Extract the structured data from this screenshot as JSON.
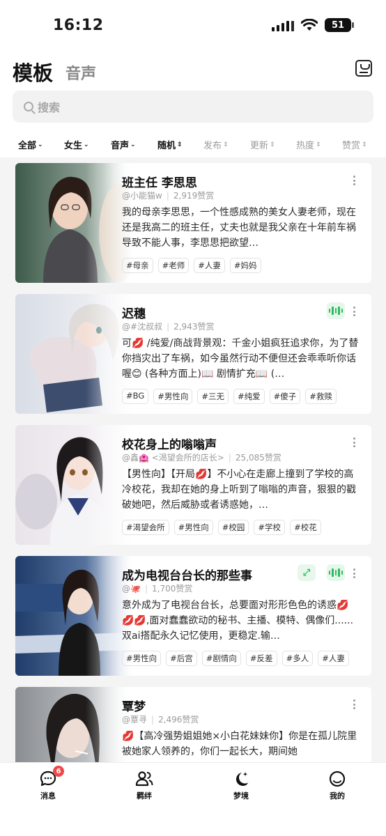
{
  "status": {
    "time": "16:12",
    "battery": "51"
  },
  "header": {
    "title": "模板",
    "subtitle": "音声"
  },
  "search": {
    "placeholder": "搜索"
  },
  "filters": [
    {
      "label": "全部",
      "active": true
    },
    {
      "label": "女生",
      "active": true
    },
    {
      "label": "音声",
      "active": true
    },
    {
      "label": "随机",
      "active": true
    },
    {
      "label": "发布",
      "active": false
    },
    {
      "label": "更新",
      "active": false
    },
    {
      "label": "热度",
      "active": false
    },
    {
      "label": "赞赏",
      "active": false
    }
  ],
  "cards": [
    {
      "title": "班主任 李思思",
      "author": "@小能猫w",
      "likes": "2,919赞赏",
      "desc": "我的母亲李思思，一个性感成熟的美女人妻老师，现在还是我高二的班主任，丈夫也就是我父亲在十年前车祸导致不能人事，李思思把欲望…",
      "tags": [
        "#母亲",
        "#老师",
        "#人妻",
        "#妈妈"
      ],
      "badges": []
    },
    {
      "title": "迟穗",
      "author": "@#沈叔叔",
      "likes": "2,943赞赏",
      "desc": "可💋 /纯爱/商战背景观：千金小姐疯狂追求你，为了替你挡灾出了车祸，如今虽然行动不便但还会乖乖听你话喔😊 (各种方面上)📖 剧情扩充📖 (…",
      "tags": [
        "#BG",
        "#男性向",
        "#三无",
        "#纯爱",
        "#傻子",
        "#救赎"
      ],
      "badges": [
        "voice"
      ]
    },
    {
      "title": "校花身上的嗡嗡声",
      "author": "@鑫🏩 <渴望会所的店长>",
      "likes": "25,085赞赏",
      "desc": "【男性向】【开局💋】不小心在走廊上撞到了学校的高冷校花，我却在她的身上听到了嗡嗡的声音，狠狠的戳破她吧，然后威胁或者诱惑她，…",
      "tags": [
        "#渴望会所",
        "#男性向",
        "#校园",
        "#学校",
        "#校花"
      ],
      "badges": []
    },
    {
      "title": "成为电视台台长的那些事",
      "author": "@🐙",
      "likes": "1,700赞赏",
      "desc": "意外成为了电视台台长，总要面对形形色色的诱惑💋💋💋,面对蠢蠢欲动的秘书、主播、模特、偶像们......双ai搭配永久记忆使用，更稳定.输…",
      "tags": [
        "#男性向",
        "#后宫",
        "#剧情向",
        "#反差",
        "#多人",
        "#人妻"
      ],
      "badges": [
        "expand",
        "voice"
      ]
    },
    {
      "title": "覃梦",
      "author": "@覃寻",
      "likes": "2,496赞赏",
      "desc": "💋【高冷强势姐姐她×小白花妹妹你】你是在孤儿院里被她家人领养的，你们一起长大，期间她",
      "tags": [],
      "badges": []
    }
  ],
  "tabbar": {
    "items": [
      {
        "label": "消息",
        "icon": "chat-bubble-icon",
        "badge": "6"
      },
      {
        "label": "羁绊",
        "icon": "people-icon"
      },
      {
        "label": "梦境",
        "icon": "moon-star-icon"
      },
      {
        "label": "我的",
        "icon": "profile-circle-icon"
      }
    ]
  },
  "colors": {
    "accent_green": "#2dbb5d",
    "badge_red": "#f04848"
  }
}
